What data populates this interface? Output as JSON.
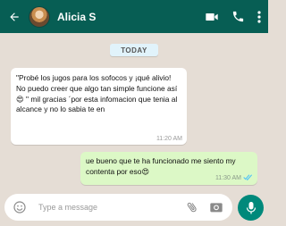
{
  "header": {
    "contact_name": "Alicia S",
    "bg_color": "#075e54"
  },
  "chat": {
    "date_label": "TODAY",
    "messages": [
      {
        "direction": "incoming",
        "text": "\"Probé los jugos para los sofocos y ¡qué alivio! No puedo creer que algo tan simple funcione así 😍 \" mil gracias ´por esta infomacion que tenia al alcance y no lo sabia te en",
        "time": "11:20 AM"
      },
      {
        "direction": "outgoing",
        "text": "ue bueno que te ha funcionado me siento my contenta por eso😍",
        "time": "11:30 AM",
        "status": "read"
      }
    ]
  },
  "composer": {
    "placeholder": "Type a message"
  },
  "icons": {
    "back": "arrow-left-icon",
    "video": "video-camera-icon",
    "call": "phone-icon",
    "menu": "more-vertical-icon",
    "emoji": "emoji-icon",
    "attach": "paperclip-icon",
    "camera": "camera-icon",
    "mic": "microphone-icon"
  },
  "colors": {
    "accent": "#00897b",
    "outgoing_bubble": "#dcf8c6",
    "chat_bg": "#e5ddd5"
  }
}
